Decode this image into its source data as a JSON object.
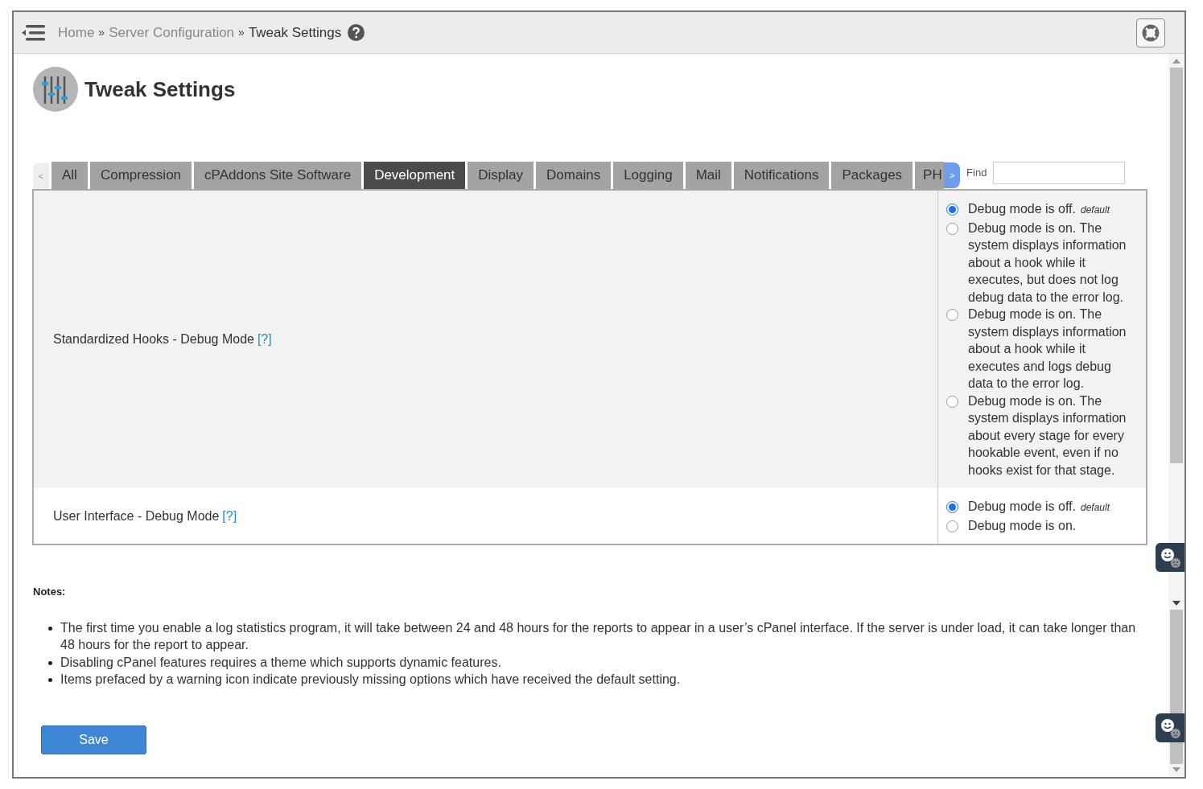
{
  "breadcrumb": [
    {
      "label": "Home",
      "current": false
    },
    {
      "label": "Server Configuration",
      "current": false
    },
    {
      "label": "Tweak Settings",
      "current": true
    }
  ],
  "breadcrumb_separator": "»",
  "page_title": "Tweak Settings",
  "tabs": [
    {
      "label": "All",
      "selected": false
    },
    {
      "label": "Compression",
      "selected": false
    },
    {
      "label": "cPAddons Site Software",
      "selected": false
    },
    {
      "label": "Development",
      "selected": true
    },
    {
      "label": "Display",
      "selected": false
    },
    {
      "label": "Domains",
      "selected": false
    },
    {
      "label": "Logging",
      "selected": false
    },
    {
      "label": "Mail",
      "selected": false
    },
    {
      "label": "Notifications",
      "selected": false
    },
    {
      "label": "Packages",
      "selected": false
    },
    {
      "label": "PH",
      "selected": false
    }
  ],
  "tab_prev": "<",
  "tab_next": ">",
  "find": {
    "label": "Find"
  },
  "settings": [
    {
      "label": "Standardized Hooks - Debug Mode",
      "help": "[?]",
      "options": [
        {
          "text": "Debug mode is off.",
          "note": "default",
          "selected": true
        },
        {
          "text": "Debug mode is on. The system displays information about a hook while it executes, but does not log debug data to the error log.",
          "selected": false
        },
        {
          "text": "Debug mode is on. The system displays information about a hook while it executes and logs debug data to the error log.",
          "selected": false
        },
        {
          "text": "Debug mode is on. The system displays information about every stage for every hookable event, even if no hooks exist for that stage.",
          "selected": false
        }
      ]
    },
    {
      "label": "User Interface - Debug Mode",
      "help": "[?]",
      "options": [
        {
          "text": "Debug mode is off.",
          "note": "default",
          "selected": true
        },
        {
          "text": "Debug mode is on.",
          "selected": false
        }
      ]
    }
  ],
  "notes": {
    "title": "Notes:",
    "items": [
      "The first time you enable a log statistics program, it will take between 24 and 48 hours for the reports to appear in a user’s cPanel interface. If the server is under load, it can take longer than 48 hours for the report to appear.",
      "Disabling cPanel features requires a theme which supports dynamic features.",
      "Items prefaced by a warning icon indicate previously missing options which have received the default setting."
    ]
  },
  "save_button": "Save"
}
